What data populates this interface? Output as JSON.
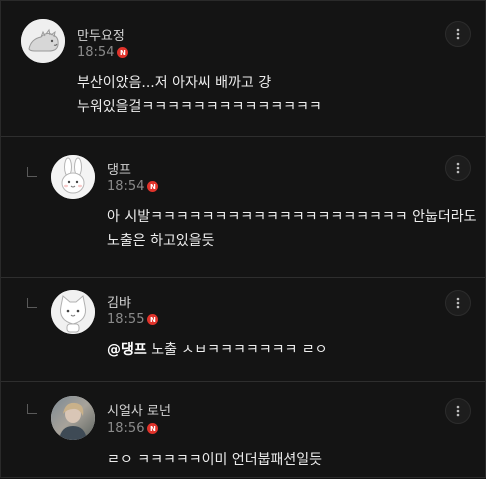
{
  "comments": [
    {
      "author": "만두요정",
      "time": "18:54",
      "badge": "N",
      "lines": [
        "부산이았음...저 아자씨 배까고 걍",
        "누워있을걸ㅋㅋㅋㅋㅋㅋㅋㅋㅋㅋㅋㅋㅋㅋ"
      ],
      "avatar_icon": "dinosaur-icon"
    },
    {
      "author": "댕프",
      "time": "18:54",
      "badge": "N",
      "lines": [
        "아 시발ㅋㅋㅋㅋㅋㅋㅋㅋㅋㅋㅋㅋㅋㅋㅋㅋㅋㅋㅋㅋ 안눕더라도",
        "노출은 하고있을듯"
      ],
      "avatar_icon": "bunny-icon"
    },
    {
      "author": "김뱌",
      "time": "18:55",
      "badge": "N",
      "mention": "@댕프",
      "lines": [
        " 노출 ㅅㅂㅋㅋㅋㅋㅋㅋㅋ ㄹㅇ"
      ],
      "avatar_icon": "cat-icon"
    },
    {
      "author": "시얼사 로넌",
      "time": "18:56",
      "badge": "N",
      "lines": [
        "ㄹㅇ ㅋㅋㅋㅋㅋ이미 언더붑패션일듯"
      ],
      "avatar_icon": "photo-avatar-icon"
    }
  ],
  "colors": {
    "background": "#141414",
    "badge": "#e0332b",
    "meta_text": "#8a8a8a"
  },
  "icons": {
    "more": "vertical-dots-icon",
    "reply": "reply-arrow-icon",
    "new": "new-badge-icon"
  }
}
